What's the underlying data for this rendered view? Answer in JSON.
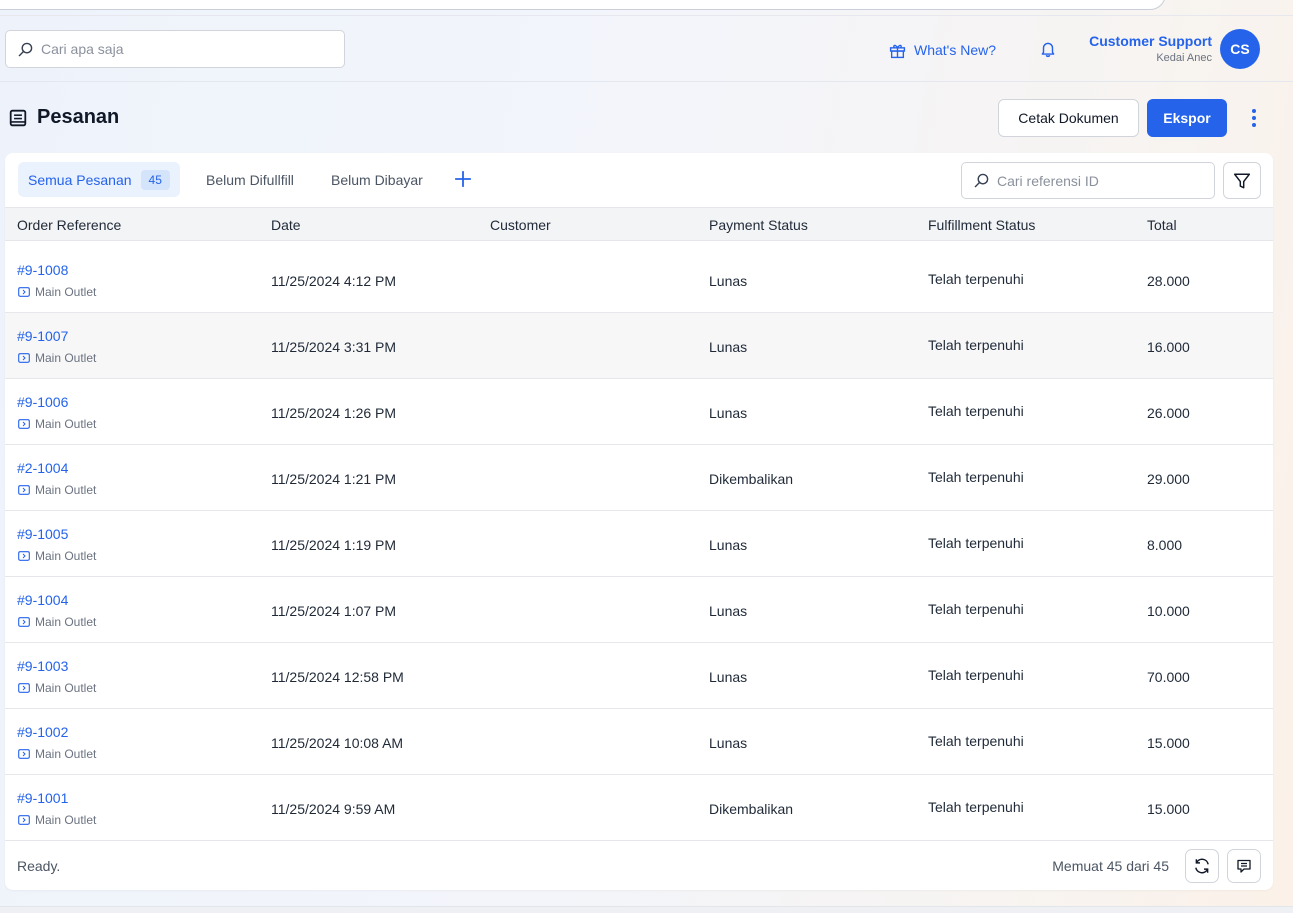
{
  "header": {
    "search_placeholder": "Cari apa saja",
    "whats_new": "What's New?",
    "user_name": "Customer Support",
    "user_store": "Kedai Anec",
    "avatar_initials": "CS"
  },
  "page": {
    "title": "Pesanan",
    "print_button": "Cetak Dokumen",
    "export_button": "Ekspor"
  },
  "tabs": [
    {
      "label": "Semua Pesanan",
      "count": "45"
    },
    {
      "label": "Belum Difullfill"
    },
    {
      "label": "Belum Dibayar"
    }
  ],
  "ref_search_placeholder": "Cari referensi ID",
  "table": {
    "columns": [
      "Order Reference",
      "Date",
      "Customer",
      "Payment Status",
      "Fulfillment Status",
      "Total"
    ],
    "rows": [
      {
        "ref": "#9-1008",
        "outlet": "Main Outlet",
        "date": "11/25/2024 4:12 PM",
        "customer": "",
        "payment": "Lunas",
        "fulfillment": "Telah terpenuhi",
        "total": "28.000"
      },
      {
        "ref": "#9-1007",
        "outlet": "Main Outlet",
        "date": "11/25/2024 3:31 PM",
        "customer": "",
        "payment": "Lunas",
        "fulfillment": "Telah terpenuhi",
        "total": "16.000"
      },
      {
        "ref": "#9-1006",
        "outlet": "Main Outlet",
        "date": "11/25/2024 1:26 PM",
        "customer": "",
        "payment": "Lunas",
        "fulfillment": "Telah terpenuhi",
        "total": "26.000"
      },
      {
        "ref": "#2-1004",
        "outlet": "Main Outlet",
        "date": "11/25/2024 1:21 PM",
        "customer": "",
        "payment": "Dikembalikan",
        "fulfillment": "Telah terpenuhi",
        "total": "29.000"
      },
      {
        "ref": "#9-1005",
        "outlet": "Main Outlet",
        "date": "11/25/2024 1:19 PM",
        "customer": "",
        "payment": "Lunas",
        "fulfillment": "Telah terpenuhi",
        "total": "8.000"
      },
      {
        "ref": "#9-1004",
        "outlet": "Main Outlet",
        "date": "11/25/2024 1:07 PM",
        "customer": "",
        "payment": "Lunas",
        "fulfillment": "Telah terpenuhi",
        "total": "10.000"
      },
      {
        "ref": "#9-1003",
        "outlet": "Main Outlet",
        "date": "11/25/2024 12:58 PM",
        "customer": "",
        "payment": "Lunas",
        "fulfillment": "Telah terpenuhi",
        "total": "70.000"
      },
      {
        "ref": "#9-1002",
        "outlet": "Main Outlet",
        "date": "11/25/2024 10:08 AM",
        "customer": "",
        "payment": "Lunas",
        "fulfillment": "Telah terpenuhi",
        "total": "15.000"
      },
      {
        "ref": "#9-1001",
        "outlet": "Main Outlet",
        "date": "11/25/2024 9:59 AM",
        "customer": "",
        "payment": "Dikembalikan",
        "fulfillment": "Telah terpenuhi",
        "total": "15.000"
      }
    ]
  },
  "footer": {
    "status": "Ready.",
    "loaded": "Memuat 45 dari 45"
  },
  "colors": {
    "accent": "#2563eb",
    "accent_light": "#eaf2fd"
  },
  "icons": [
    "search-icon",
    "gift-icon",
    "bell-icon",
    "document-icon",
    "kebab-icon",
    "plus-icon",
    "filter-icon",
    "outlet-icon",
    "refresh-icon",
    "chat-icon"
  ]
}
